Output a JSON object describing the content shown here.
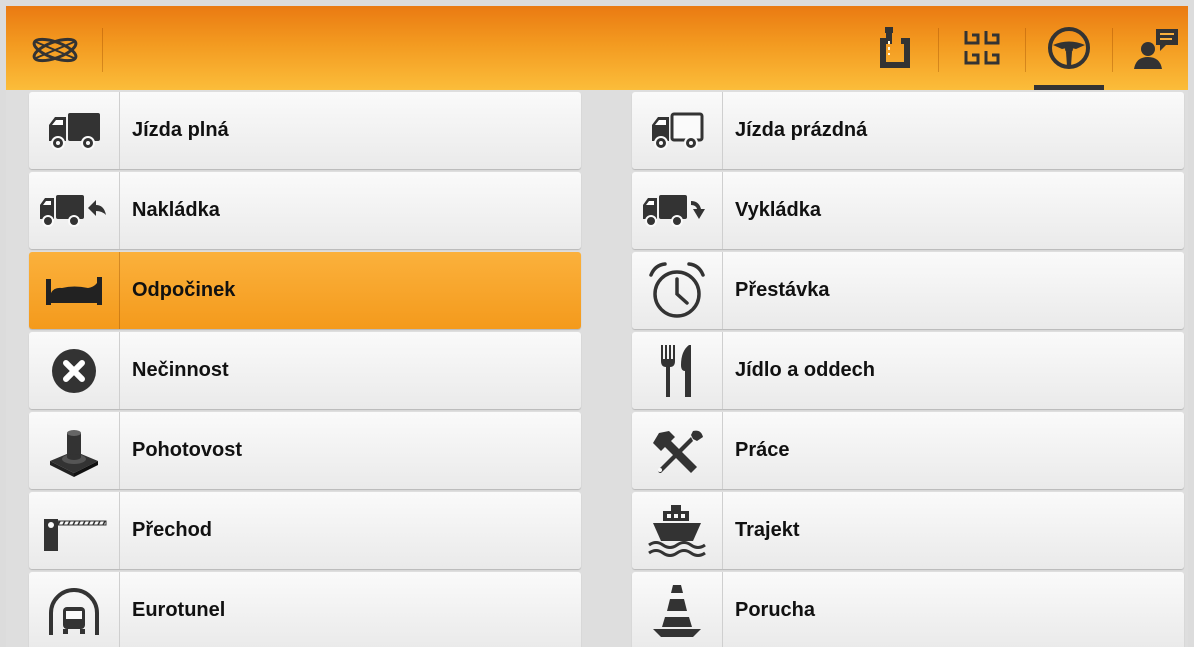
{
  "header": {
    "logo_icon": "eurowag-logo-icon",
    "buttons": [
      {
        "name": "route-button",
        "icon": "route-icon"
      },
      {
        "name": "grid-button",
        "icon": "grid-icon"
      },
      {
        "name": "driving-button",
        "icon": "steering-wheel-icon",
        "active": true
      },
      {
        "name": "messages-button",
        "icon": "user-message-icon"
      }
    ],
    "active_indicator_color": "#333333"
  },
  "colors": {
    "accent": "#F49A1C",
    "header_gradient_top": "#EA7A12",
    "header_gradient_bottom": "#FBBD3A"
  },
  "activities": {
    "left": [
      {
        "label": "Jízda plná",
        "icon": "full-truck-icon"
      },
      {
        "label": "Nakládka",
        "icon": "loading-icon"
      },
      {
        "label": "Odpočinek",
        "icon": "bed-icon",
        "selected": true
      },
      {
        "label": "Nečinnost",
        "icon": "x-circle-icon"
      },
      {
        "label": "Pohotovost",
        "icon": "standby-button-icon"
      },
      {
        "label": "Přechod",
        "icon": "border-barrier-icon"
      },
      {
        "label": "Eurotunel",
        "icon": "tunnel-icon"
      }
    ],
    "right": [
      {
        "label": "Jízda prázdná",
        "icon": "empty-truck-icon"
      },
      {
        "label": "Vykládka",
        "icon": "unloading-icon"
      },
      {
        "label": "Přestávka",
        "icon": "alarm-clock-icon"
      },
      {
        "label": "Jídlo a oddech",
        "icon": "fork-knife-icon"
      },
      {
        "label": "Práce",
        "icon": "tools-icon"
      },
      {
        "label": "Trajekt",
        "icon": "ferry-icon"
      },
      {
        "label": "Porucha",
        "icon": "traffic-cone-icon"
      }
    ]
  }
}
